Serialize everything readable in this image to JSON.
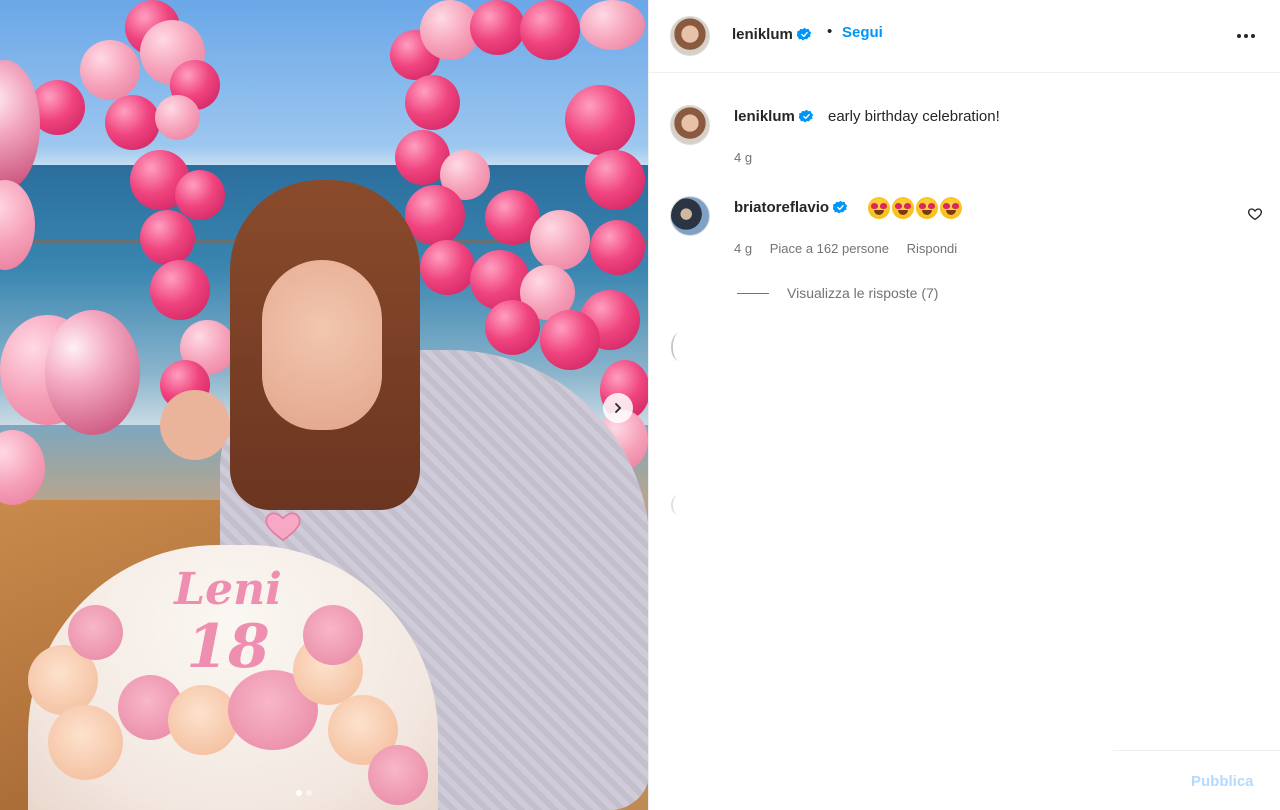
{
  "post": {
    "author": "leniklum",
    "follow_label": "Segui",
    "separator": "•"
  },
  "caption": {
    "author": "leniklum",
    "text": "early birthday celebration!",
    "time": "4 g"
  },
  "comments": [
    {
      "author": "briatoreflavio",
      "emojis": [
        "star-struck-emoji",
        "star-struck-emoji",
        "star-struck-emoji",
        "star-struck-emoji"
      ],
      "time": "4 g",
      "likes": "Piace a 162 persone",
      "reply_label": "Rispondi",
      "view_replies": "Visualizza le risposte (7)"
    }
  ],
  "photo": {
    "cake_name": "Leni",
    "cake_age": "18",
    "carousel_position": 1,
    "carousel_count": 2
  },
  "composer": {
    "post_label": "Pubblica"
  },
  "colors": {
    "verified": "#0095f6",
    "follow": "#0095f6",
    "post_disabled": "#b3dbff"
  },
  "icons": [
    "verified-badge-icon",
    "more-options-icon",
    "heart-icon",
    "chevron-right-icon"
  ]
}
